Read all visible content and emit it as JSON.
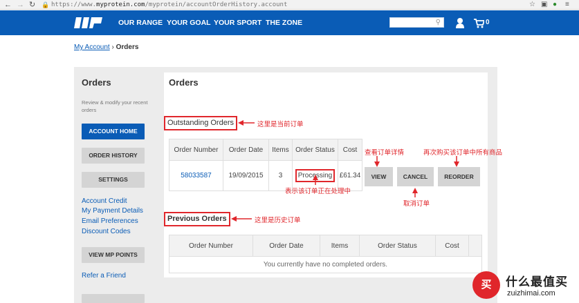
{
  "browser": {
    "url_prefix": "https://www.",
    "url_domain": "myprotein.com",
    "url_path": "/myprotein/accountOrderHistory.account"
  },
  "header": {
    "nav": [
      "OUR RANGE",
      "YOUR GOAL",
      "YOUR SPORT",
      "THE ZONE"
    ],
    "cart_count": "0",
    "colors": {
      "brand": "#0a5cb6",
      "annotation": "#e0262b"
    }
  },
  "breadcrumb": {
    "link": "My Account",
    "separator": "›",
    "current": "Orders"
  },
  "sidebar": {
    "title": "Orders",
    "description": "Review & modify your recent orders",
    "buttons": {
      "account_home": "ACCOUNT HOME",
      "order_history": "ORDER HISTORY",
      "settings": "SETTINGS",
      "view_mp_points": "VIEW MP POINTS"
    },
    "links": [
      "Account Credit",
      "My Payment Details",
      "Email Preferences",
      "Discount Codes"
    ],
    "refer": "Refer a Friend"
  },
  "main": {
    "title": "Orders",
    "outstanding": {
      "heading": "Outstanding Orders",
      "columns": [
        "Order Number",
        "Order Date",
        "Items",
        "Order Status",
        "Cost"
      ],
      "row": {
        "number": "58033587",
        "date": "19/09/2015",
        "items": "3",
        "status": "Processing",
        "cost": "£61.34"
      },
      "actions": {
        "view": "VIEW",
        "cancel": "CANCEL",
        "reorder": "REORDER"
      }
    },
    "previous": {
      "heading": "Previous Orders",
      "columns": [
        "Order Number",
        "Order Date",
        "Items",
        "Order Status",
        "Cost"
      ],
      "empty": "You currently have no completed orders."
    }
  },
  "annotations": {
    "current_orders": "这里是当前订单",
    "view_details": "查看订单详情",
    "reorder_all": "再次购买该订单中所有商品",
    "processing": "表示该订单正在处理中",
    "cancel_order": "取消订单",
    "history_orders": "这里是历史订单"
  },
  "watermark": {
    "cn": "什么最值买",
    "en": "zuizhimai.com",
    "badge": "买"
  }
}
